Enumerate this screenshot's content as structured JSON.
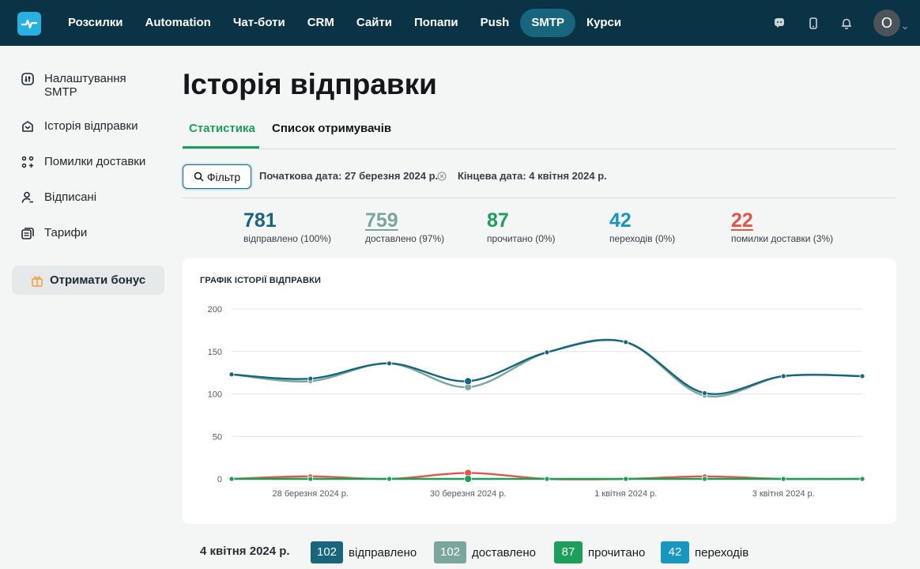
{
  "nav": {
    "items": [
      "Розсилки",
      "Automation",
      "Чат-боти",
      "CRM",
      "Сайти",
      "Попапи",
      "Push",
      "SMTP",
      "Курси"
    ],
    "active_index": 7,
    "avatar_letter": "O"
  },
  "sidebar": {
    "items": [
      {
        "label": "Налаштування SMTP",
        "icon": "settings-sliders-icon"
      },
      {
        "label": "Історія відправки",
        "icon": "inbox-history-icon"
      },
      {
        "label": "Помилки доставки",
        "icon": "delivery-errors-icon"
      },
      {
        "label": "Відписані",
        "icon": "unsubscribed-user-icon"
      },
      {
        "label": "Тарифи",
        "icon": "tariffs-icon"
      }
    ],
    "bonus_label": "Отримати бонус"
  },
  "page": {
    "title": "Історія відправки",
    "tabs": [
      "Статистика",
      "Список отримувачів"
    ],
    "filter_label": "Фільтр",
    "start_date": "Початкова дата: 27 березня 2024 р.",
    "end_date": "Кінцева дата: 4 квітня 2024 р."
  },
  "stats": [
    {
      "value": "781",
      "label": "відправлено (100%)",
      "color": "#17667e"
    },
    {
      "value": "759",
      "label": "доставлено (97%)",
      "color": "#7aa69c"
    },
    {
      "value": "87",
      "label": "прочитано (0%)",
      "color": "#1aa058"
    },
    {
      "value": "42",
      "label": "переходів (0%)",
      "color": "#1797c0"
    },
    {
      "value": "22",
      "label": "помилки доставки (3%)",
      "color": "#e2564a"
    }
  ],
  "chart_title": "ГРАФІК ІСТОРІЇ ВІДПРАВКИ",
  "chart_data": {
    "type": "line",
    "x": [
      "27 березня 2024 р.",
      "28 березня 2024 р.",
      "29 березня 2024 р.",
      "30 березня 2024 р.",
      "31 березня 2024 р.",
      "1 квітня 2024 р.",
      "2 квітня 2024 р.",
      "3 квітня 2024 р.",
      "4 квітня 2024 р."
    ],
    "x_tick_labels": [
      "28 березня 2024 р.",
      "30 березня 2024 р.",
      "1 квітня 2024 р.",
      "3 квітня 2024 р."
    ],
    "y_ticks": [
      "200",
      "150",
      "100",
      "50",
      "0"
    ],
    "ylim": [
      0,
      200
    ],
    "grid": true,
    "series": [
      {
        "name": "відправлено",
        "color": "#17667e",
        "values": [
          123,
          118,
          136,
          115,
          149,
          161,
          101,
          121,
          121
        ]
      },
      {
        "name": "доставлено",
        "color": "#7aa69c",
        "values": [
          123,
          115,
          136,
          108,
          149,
          161,
          98,
          121,
          121
        ]
      },
      {
        "name": "помилки доставки",
        "color": "#e2564a",
        "values": [
          0,
          3,
          0,
          7,
          0,
          0,
          3,
          0,
          0
        ]
      },
      {
        "name": "прочитано",
        "color": "#1aa058",
        "values": [
          0,
          0,
          0,
          0,
          0,
          0,
          0,
          0,
          0
        ]
      }
    ]
  },
  "summary": {
    "date": "4 квітня 2024 р.",
    "items": [
      {
        "value": "102",
        "label": "відправлено",
        "color": "#17667e"
      },
      {
        "value": "102",
        "label": "доставлено",
        "color": "#7aa69c"
      },
      {
        "value": "87",
        "label": "прочитано",
        "color": "#1aa058"
      },
      {
        "value": "42",
        "label": "переходів",
        "color": "#1797c0"
      }
    ]
  }
}
